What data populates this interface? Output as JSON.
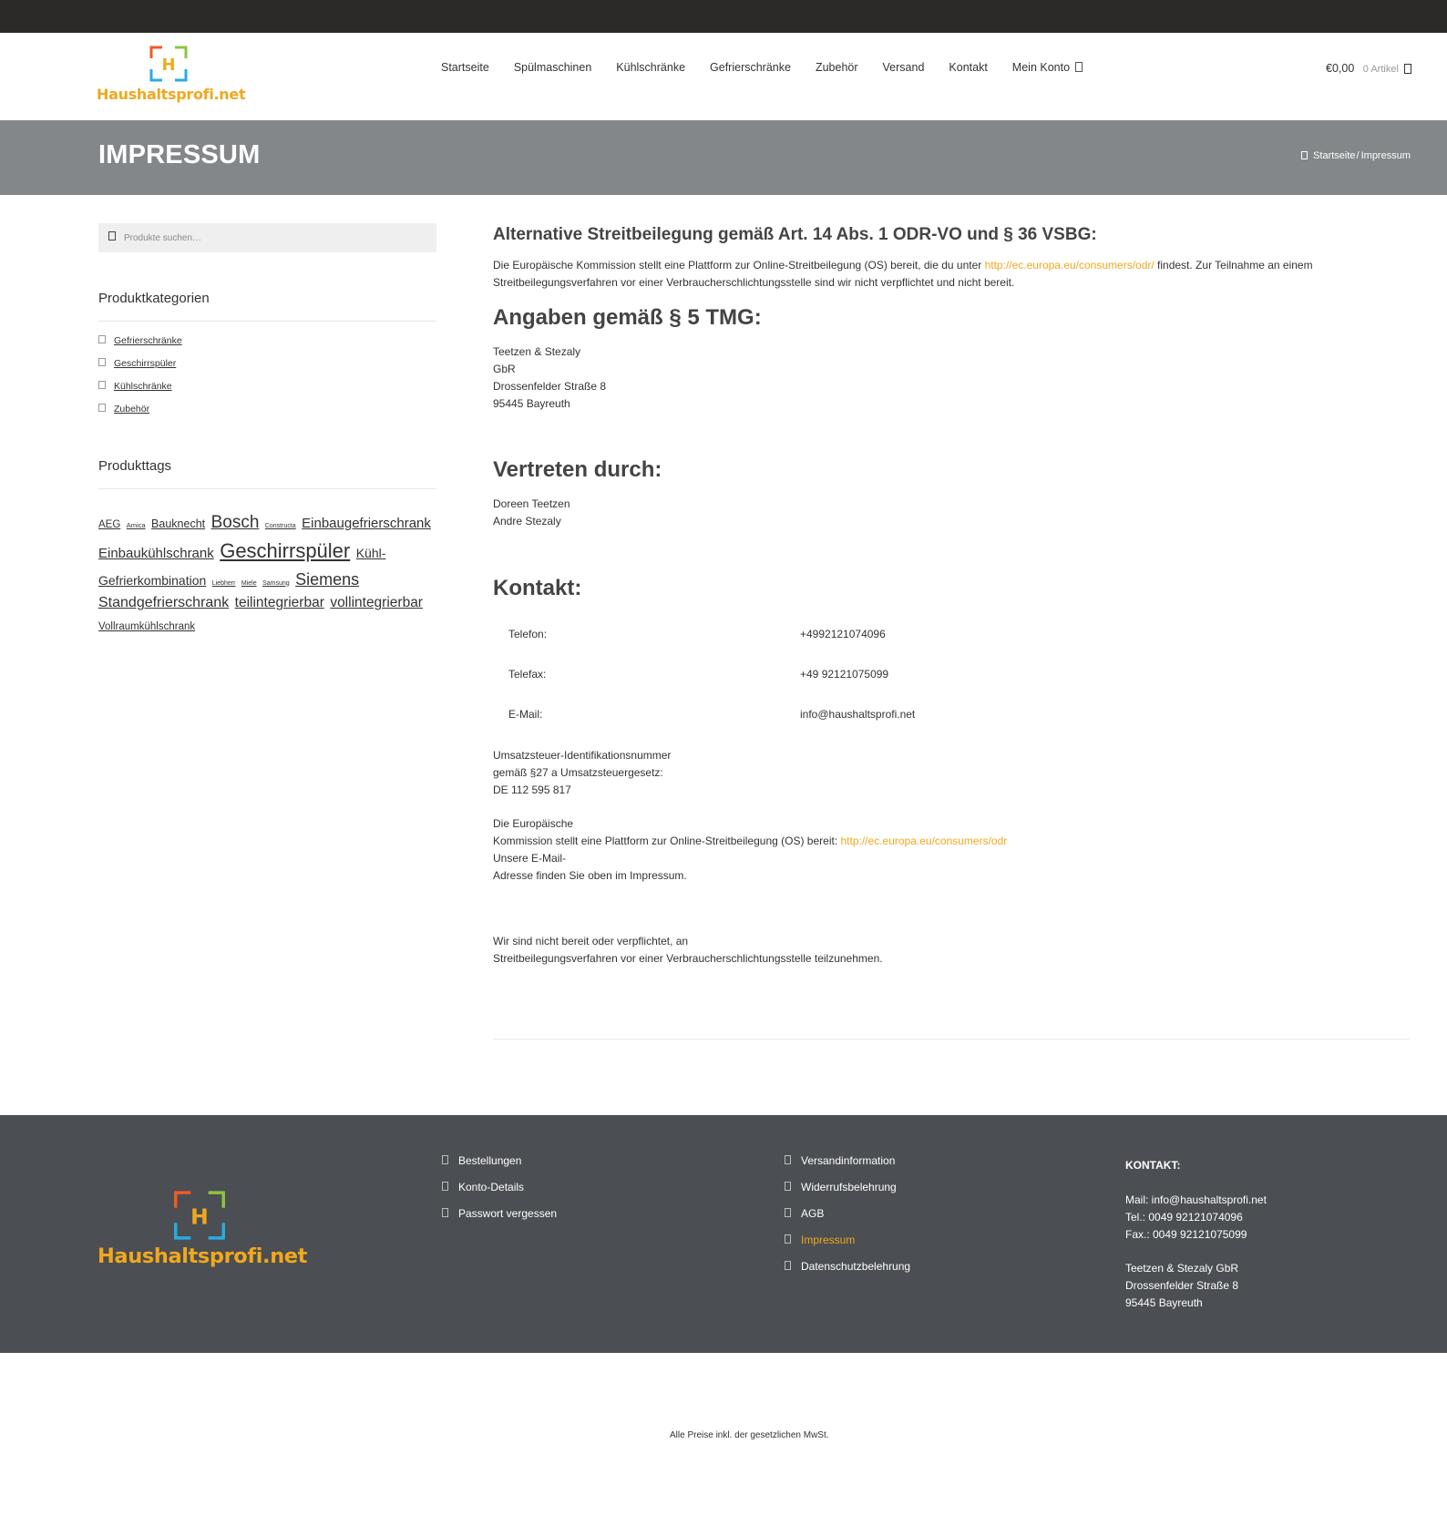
{
  "brand": {
    "name": "Haushaltsprofi.net",
    "letter": "H",
    "accent": "#f0a81e"
  },
  "nav": {
    "items": [
      "Startseite",
      "Spülmaschinen",
      "Kühlschränke",
      "Gefrierschränke",
      "Zubehör",
      "Versand",
      "Kontakt",
      "Mein Konto"
    ]
  },
  "cart": {
    "total": "€0,00",
    "items": "0 Artikel",
    "icon": "shopping-bag-icon"
  },
  "page": {
    "title": "IMPRESSUM"
  },
  "breadcrumb": {
    "home": "Startseite",
    "separator": "/",
    "current": "Impressum"
  },
  "search": {
    "placeholder": "Produkte suchen…"
  },
  "sidebar": {
    "categories_title": "Produktkategorien",
    "categories": [
      "Gefrierschränke",
      "Geschirrspüler",
      "Kühlschränke",
      "Zubehör"
    ],
    "tags_title": "Produkttags",
    "tags": [
      "AEG",
      "Amica",
      "Bauknecht",
      "Bosch",
      "Constructa",
      "Einbaugefrierschrank",
      "Einbaukühlschrank",
      "Geschirrspüler",
      "Kühl-Gefrierkombination",
      "Liebherr",
      "Miele",
      "Samsung",
      "Siemens",
      "Standgefrierschrank",
      "teilintegrierbar",
      "vollintegrierbar",
      "Vollraumkühlschrank"
    ]
  },
  "content": {
    "h_streit": "Alternative Streitbeilegung gemäß Art. 14 Abs. 1 ODR-VO und § 36 VSBG:",
    "p_streit_before": "Die Europäische Kommission stellt eine Plattform zur Online-Streitbeilegung (OS) bereit, die du unter ",
    "p_streit_link": "http://ec.europa.eu/consumers/odr/",
    "p_streit_after": " findest. Zur Teilnahme an einem Streitbeilegungsverfahren vor einer Verbraucherschlichtungsstelle sind wir nicht verpflichtet und nicht bereit.",
    "h_angaben": "Angaben gemäß § 5 TMG:",
    "address": [
      "Teetzen & Stezaly",
      "GbR",
      "Drossenfelder Straße 8",
      "95445 Bayreuth"
    ],
    "h_vertreten": "Vertreten durch:",
    "representatives": [
      "Doreen Teetzen",
      "Andre Stezaly"
    ],
    "h_kontakt": "Kontakt:",
    "contact": [
      {
        "label": "Telefon:",
        "value": "+4992121074096"
      },
      {
        "label": "Telefax:",
        "value": "+49 92121075099"
      },
      {
        "label": "E-Mail:",
        "value": "info@haushaltsprofi.net"
      }
    ],
    "ust": [
      "Umsatzsteuer-Identifikationsnummer",
      "gemäß §27 a Umsatzsteuergesetz:",
      "DE 112 595 817"
    ],
    "eu_line1": "Die Europäische",
    "eu_line2": "Kommission stellt eine Plattform zur Online-Streitbeilegung (OS) bereit: ",
    "eu_link": "http://ec.europa.eu/consumers/odr",
    "eu_line3": "Unsere E-Mail-",
    "eu_line4": "Adresse finden Sie oben im Impressum.",
    "final_line1": "Wir sind nicht bereit oder verpflichtet, an",
    "final_line2": "Streitbeilegungsverfahren vor einer Verbraucherschlichtungsstelle teilzunehmen."
  },
  "footer": {
    "col1": [
      "Bestellungen",
      "Konto-Details",
      "Passwort vergessen"
    ],
    "col2": [
      "Versandinformation",
      "Widerrufsbelehrung",
      "AGB",
      "Impressum",
      "Datenschutzbelehrung"
    ],
    "contact_title": "KONTAKT:",
    "contact_lines": [
      "Mail: info@haushaltsprofi.net",
      "Tel.: 0049 92121074096",
      "Fax.: 0049 92121075099"
    ],
    "address_lines": [
      "Teetzen & Stezaly GbR",
      "Drossenfelder Straße 8",
      "95445 Bayreuth"
    ]
  },
  "note": "Alle Preise inkl. der gesetzlichen MwSt."
}
